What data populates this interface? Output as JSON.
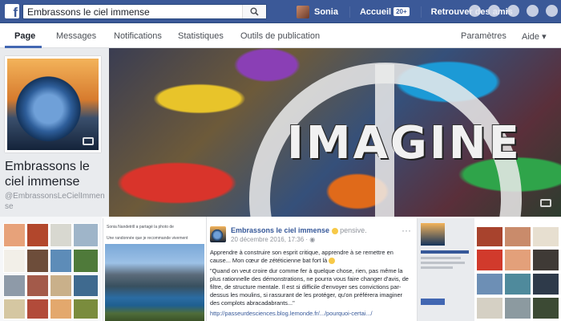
{
  "topbar": {
    "search_value": "Embrassons le ciel immense",
    "user_name": "Sonia",
    "home_label": "Accueil",
    "home_badge": "20+",
    "find_friends_label": "Retrouver des amis"
  },
  "tabs": {
    "page": "Page",
    "messages": "Messages",
    "notifications": "Notifications",
    "stats": "Statistiques",
    "publishing": "Outils de publication",
    "settings": "Paramètres",
    "help": "Aide"
  },
  "profile": {
    "name": "Embrassons le ciel immense",
    "handle": "@EmbrassonsLeCielImmense"
  },
  "cover": {
    "text": "IMAGINE"
  },
  "post": {
    "page_name": "Embrassons le ciel immense",
    "feeling": "pensive.",
    "date": "20 décembre 2016, 17:36 · ",
    "paragraph1": "Apprendre à construire son esprit critique, apprendre à se remettre en cause... Mon cœur de zététicienne bat fort là",
    "paragraph2": "\"Quand on veut croire dur comme fer à quelque chose, rien, pas même la plus rationnelle des démonstrations, ne pourra vous faire changer d'avis, de filtre, de structure mentale. Il est si difficile d'envoyer ses convictions par-dessus les moulins, si rassurant de les protéger, qu'on préférera imaginer des complots abracadabrants...\"",
    "link": "http://passeurdesciences.blog.lemonde.fr/.../pourquoi-certai.../"
  },
  "small_post": {
    "author_line": "Sonia Nandetrill a partagé la photo de",
    "caption": "Une randonnée que je recommande vivement"
  },
  "colors": {
    "brand": "#3b5998",
    "link": "#365899",
    "tab_active": "#4267b2"
  }
}
